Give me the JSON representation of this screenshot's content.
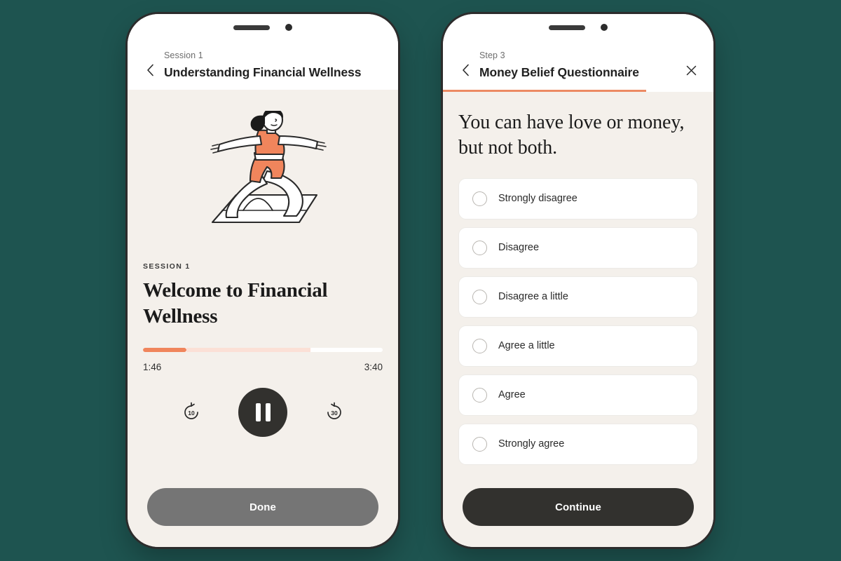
{
  "background_color": "#1e5450",
  "accent_color": "#ec8a63",
  "phones": {
    "player": {
      "name": "financial-wellness-audio-player",
      "header": {
        "eyebrow": "Session 1",
        "title": "Understanding Financial Wellness",
        "back_icon": "chevron-left-icon"
      },
      "illustration": {
        "name": "woman-yoga-warrior-pose-illustration",
        "skin_color": "#ffffff",
        "outfit_color": "#f0855c",
        "hair_color": "#1b1b1b",
        "line_color": "#2a2a2a"
      },
      "kicker": "SESSION 1",
      "title": "Welcome to Financial Wellness",
      "progress": {
        "played_percent": 18,
        "buffered_percent": 52,
        "played_color": "#f0855c",
        "buffer_color": "#fbe0d6",
        "track_color": "#ffffff"
      },
      "elapsed_time": "1:46",
      "total_time": "3:40",
      "controls": {
        "rewind_label": "10",
        "rewind_icon": "rewind-10-icon",
        "play_state": "playing",
        "play_icon": "pause-icon",
        "forward_label": "30",
        "forward_icon": "forward-30-icon"
      },
      "cta_label": "Done",
      "cta_state": "disabled",
      "cta_color": "#757575"
    },
    "questionnaire": {
      "name": "money-belief-questionnaire",
      "header": {
        "eyebrow": "Step 3",
        "title": "Money Belief Questionnaire",
        "back_icon": "chevron-left-icon",
        "close_icon": "close-icon"
      },
      "step_progress_percent": 75,
      "question": "You can have love or money, but not both.",
      "options": [
        {
          "label": "Strongly disagree",
          "selected": false
        },
        {
          "label": "Disagree",
          "selected": false
        },
        {
          "label": "Disagree a little",
          "selected": false
        },
        {
          "label": "Agree a little",
          "selected": false
        },
        {
          "label": "Agree",
          "selected": false
        },
        {
          "label": "Strongly agree",
          "selected": false
        }
      ],
      "cta_label": "Continue",
      "cta_state": "enabled",
      "cta_color": "#32312e"
    }
  }
}
